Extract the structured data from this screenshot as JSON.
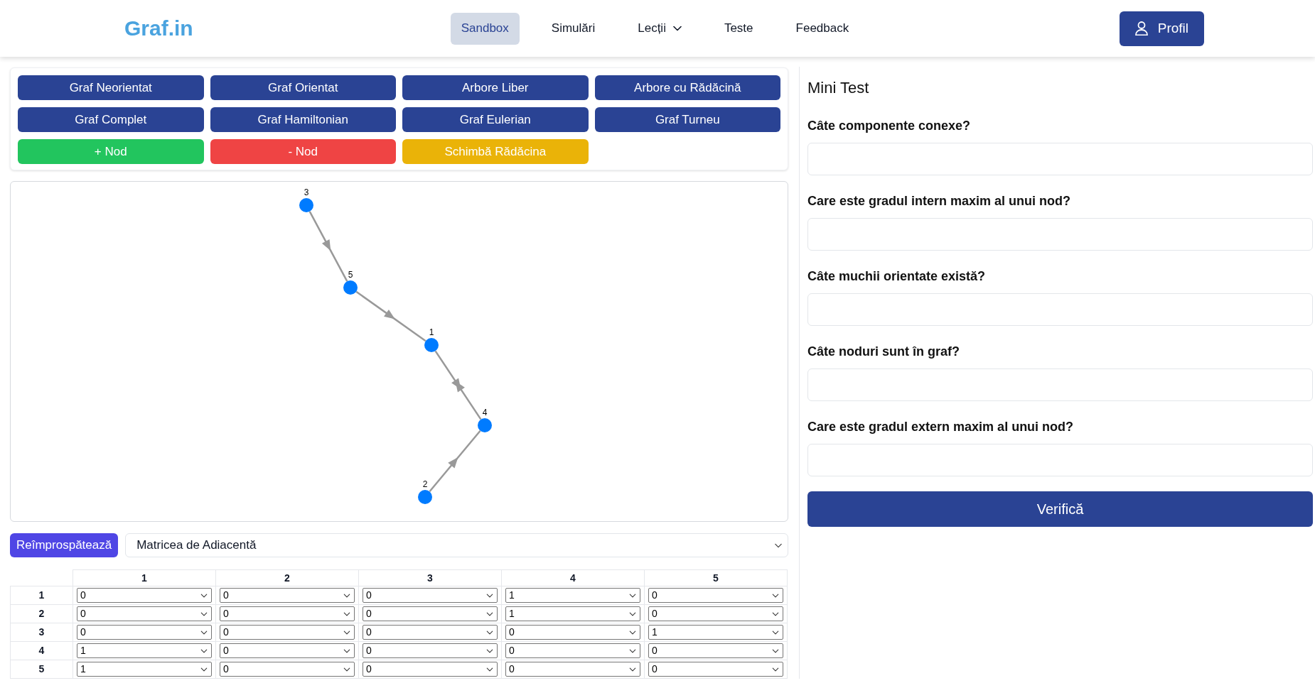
{
  "header": {
    "logo": "Graf.in",
    "nav": [
      {
        "label": "Sandbox",
        "selected": true,
        "kind": "link"
      },
      {
        "label": "Simulări",
        "selected": false,
        "kind": "link"
      },
      {
        "label": "Lecții",
        "selected": false,
        "kind": "dropdown"
      },
      {
        "label": "Teste",
        "selected": false,
        "kind": "link"
      },
      {
        "label": "Feedback",
        "selected": false,
        "kind": "link"
      }
    ],
    "profile_button": "Profil"
  },
  "graph_buttons": [
    {
      "label": "Graf Neorientat",
      "kind": "graph"
    },
    {
      "label": "Graf Orientat",
      "kind": "graph"
    },
    {
      "label": "Arbore Liber",
      "kind": "graph"
    },
    {
      "label": "Arbore cu Rădăcină",
      "kind": "graph"
    },
    {
      "label": "Graf Complet",
      "kind": "graph"
    },
    {
      "label": "Graf Hamiltonian",
      "kind": "graph"
    },
    {
      "label": "Graf Eulerian",
      "kind": "graph"
    },
    {
      "label": "Graf Turneu",
      "kind": "graph"
    },
    {
      "label": "+ Nod",
      "kind": "add"
    },
    {
      "label": "- Nod",
      "kind": "remove"
    },
    {
      "label": "Schimbă Rădăcina",
      "kind": "root"
    }
  ],
  "graph": {
    "nodes": [
      {
        "label": "3"
      },
      {
        "label": "5"
      },
      {
        "label": "1"
      },
      {
        "label": "4"
      },
      {
        "label": "2"
      }
    ]
  },
  "matrix_toolbar": {
    "refresh_button": "Reîmprospătează",
    "view_select": {
      "value": "Matricea de Adiacentă"
    }
  },
  "adjacency_matrix": {
    "columns": [
      "1",
      "2",
      "3",
      "4",
      "5"
    ],
    "rows": [
      {
        "label": "1",
        "cells": [
          "0",
          "0",
          "0",
          "1",
          "0"
        ]
      },
      {
        "label": "2",
        "cells": [
          "0",
          "0",
          "0",
          "1",
          "0"
        ]
      },
      {
        "label": "3",
        "cells": [
          "0",
          "0",
          "0",
          "0",
          "1"
        ]
      },
      {
        "label": "4",
        "cells": [
          "1",
          "0",
          "0",
          "0",
          "0"
        ]
      },
      {
        "label": "5",
        "cells": [
          "1",
          "0",
          "0",
          "0",
          "0"
        ]
      }
    ]
  },
  "mini_test": {
    "title": "Mini Test",
    "questions": [
      {
        "label": "Câte componente conexe?"
      },
      {
        "label": "Care este gradul intern maxim al unui nod?"
      },
      {
        "label": "Câte muchii orientate există?"
      },
      {
        "label": "Câte noduri sunt în graf?"
      },
      {
        "label": "Care este gradul extern maxim al unui nod?"
      }
    ],
    "submit_button": "Verifică"
  }
}
